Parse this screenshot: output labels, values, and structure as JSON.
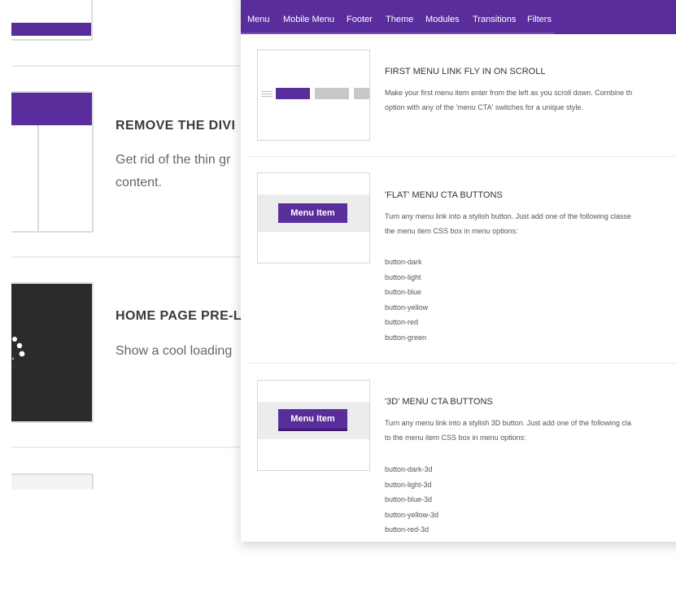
{
  "colors": {
    "accent": "#5a2d9c",
    "accent_dark": "#4b2288",
    "background_dark_tile": "#2b2b2b"
  },
  "background_page": {
    "sections": [
      {
        "title": "REMOVE THE DIVI",
        "description_line1": "Get rid of the thin gr",
        "description_line2": "content."
      },
      {
        "title": "HOME PAGE PRE-L",
        "description_line1": "Show a cool loading"
      }
    ]
  },
  "panel": {
    "tabs": [
      "Menu",
      "Mobile Menu",
      "Footer",
      "Theme",
      "Modules",
      "Transitions",
      "Filters"
    ],
    "options": [
      {
        "title": "FIRST MENU LINK FLY IN ON SCROLL",
        "desc_line1": "Make your first menu item enter from the left as you scroll down. Combine th",
        "desc_line2": "option with any of the 'menu CTA' switches for a unique style."
      },
      {
        "title": "'FLAT' MENU CTA BUTTONS",
        "preview_button": "Menu Item",
        "desc_line1": "Turn any menu link into a stylish button. Just add one of the following classe",
        "desc_line2": "the menu item CSS box in menu options:",
        "classes": [
          "button-dark",
          "button-light",
          "button-blue",
          "button-yellow",
          "button-red",
          "button-green"
        ]
      },
      {
        "title": "'3D' MENU CTA BUTTONS",
        "preview_button": "Menu Item",
        "desc_line1": "Turn any menu link into a stylish 3D button. Just add one of the following cla",
        "desc_line2": "to the menu item CSS box in menu options:",
        "classes": [
          "button-dark-3d",
          "button-light-3d",
          "button-blue-3d",
          "button-yellow-3d",
          "button-red-3d"
        ]
      }
    ]
  }
}
